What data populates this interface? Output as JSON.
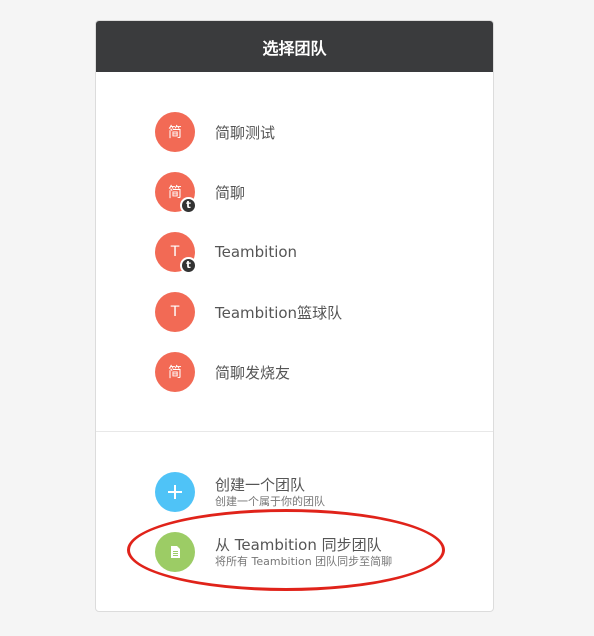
{
  "header": {
    "title": "选择团队"
  },
  "teams": [
    {
      "avatar": "简",
      "name": "简聊测试",
      "badge": ""
    },
    {
      "avatar": "简",
      "name": "简聊",
      "badge": "t"
    },
    {
      "avatar": "T",
      "name": "Teambition",
      "badge": "t"
    },
    {
      "avatar": "T",
      "name": "Teambition篮球队",
      "badge": ""
    },
    {
      "avatar": "简",
      "name": "简聊发烧友",
      "badge": ""
    }
  ],
  "actions": {
    "create": {
      "title": "创建一个团队",
      "subtitle": "创建一个属于你的团队",
      "icon": "plus-icon"
    },
    "sync": {
      "title": "从 Teambition 同步团队",
      "subtitle": "将所有 Teambition 团队同步至简聊",
      "icon": "document-icon"
    }
  },
  "colors": {
    "header_bg": "#3a3b3d",
    "team_avatar": "#f26a55",
    "create_icon_bg": "#4fc3f7",
    "sync_icon_bg": "#9ccc65",
    "highlight_oval": "#e0231a"
  }
}
